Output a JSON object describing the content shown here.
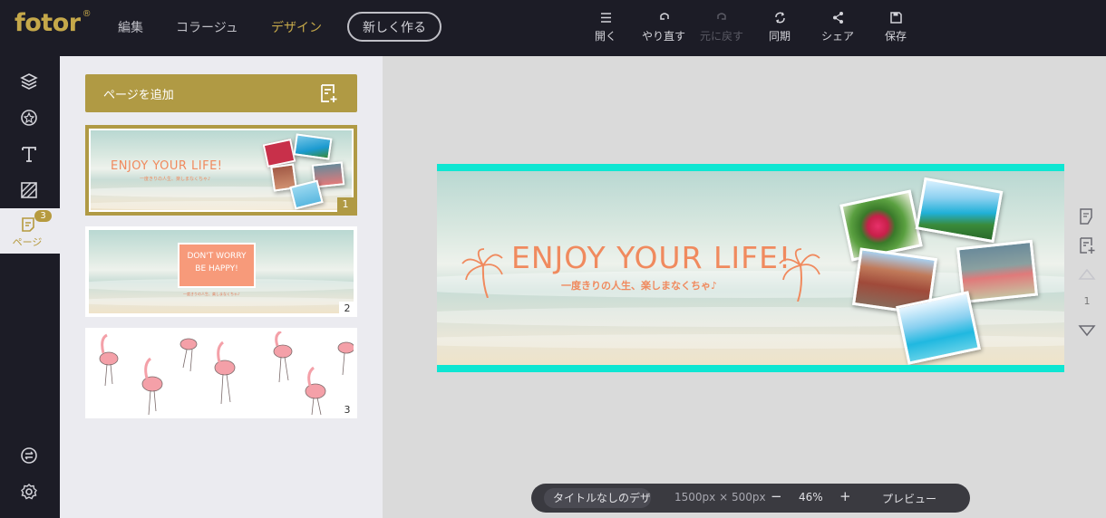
{
  "logo": {
    "text": "fotor",
    "mark": "®"
  },
  "nav": {
    "items": [
      {
        "label": "編集",
        "active": false
      },
      {
        "label": "コラージュ",
        "active": false
      },
      {
        "label": "デザイン",
        "active": true
      }
    ],
    "new_label": "新しく作る"
  },
  "toolbar": [
    {
      "label": "開く",
      "icon": "menu-icon",
      "enabled": true
    },
    {
      "label": "やり直す",
      "icon": "undo-icon",
      "enabled": true
    },
    {
      "label": "元に戻す",
      "icon": "redo-icon",
      "enabled": false
    },
    {
      "label": "同期",
      "icon": "sync-icon",
      "enabled": true
    },
    {
      "label": "シェア",
      "icon": "share-icon",
      "enabled": true
    },
    {
      "label": "保存",
      "icon": "save-icon",
      "enabled": true
    }
  ],
  "rail": {
    "icons": [
      "layers-icon",
      "sticker-icon",
      "text-icon",
      "background-icon"
    ],
    "active": {
      "label": "ページ",
      "badge": "3",
      "icon": "page-icon"
    },
    "bottom_icons": [
      "adjust-icon",
      "settings-icon"
    ]
  },
  "panel": {
    "add_page_label": "ページを追加",
    "pages": [
      {
        "number": "1",
        "selected": true,
        "title": "ENJOY YOUR LIFE!",
        "subtitle": "一度きりの人生、楽しまなくちゃ♪"
      },
      {
        "number": "2",
        "selected": false,
        "title_line1": "DON'T WORRY",
        "title_line2": "BE HAPPY!",
        "subtitle": "一度きりの人生、楽しまなくちゃ♪"
      },
      {
        "number": "3",
        "selected": false
      }
    ]
  },
  "canvas": {
    "title": "ENJOY YOUR LIFE!",
    "subtitle": "一度きりの人生、楽しまなくちゃ♪",
    "border_color": "#0ee6d2",
    "text_color": "#f08a5e"
  },
  "right_rail": {
    "page_number": "1",
    "icons": [
      "page-duplicate-icon",
      "page-add-icon",
      "page-up-icon",
      "page-down-icon"
    ]
  },
  "bottom_bar": {
    "title": "タイトルなしのデザイン",
    "dimensions": "1500px × 500px",
    "zoom_out": "−",
    "zoom": "46%",
    "zoom_in": "+",
    "preview": "プレビュー"
  },
  "colors": {
    "accent": "#b09a44",
    "dark": "#1c1c26",
    "panel": "#ebebf0"
  }
}
